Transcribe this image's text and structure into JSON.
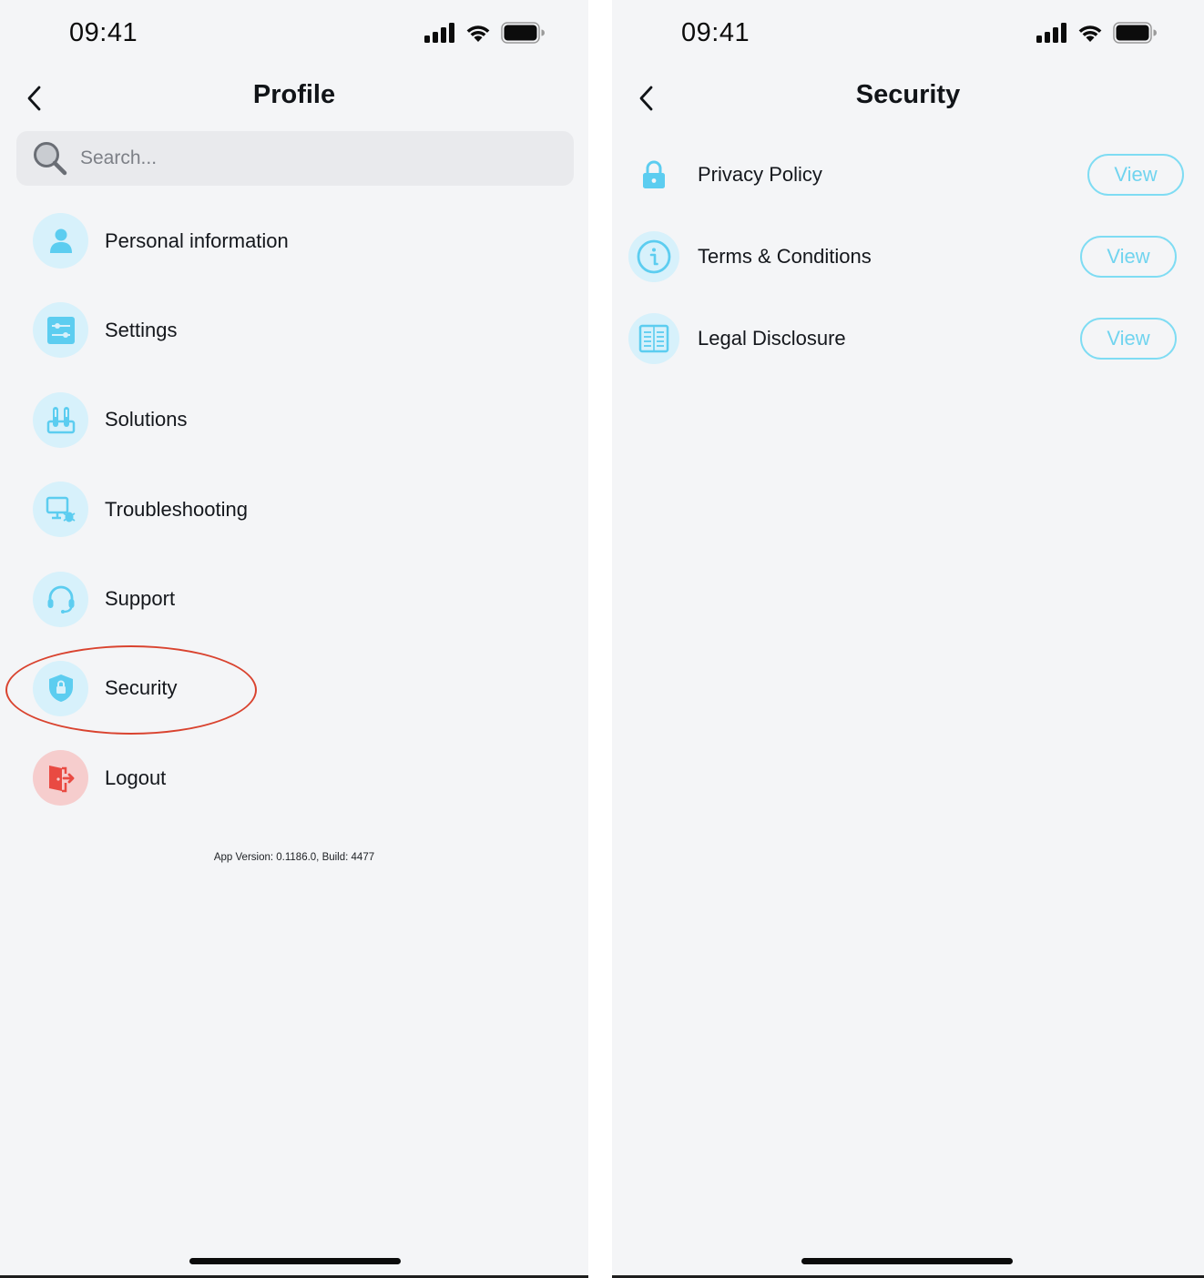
{
  "left_screen": {
    "status": {
      "time": "09:41"
    },
    "header": {
      "title": "Profile"
    },
    "search": {
      "placeholder": "Search..."
    },
    "menu": [
      {
        "label": "Personal information",
        "icon": "user-icon"
      },
      {
        "label": "Settings",
        "icon": "sliders-icon"
      },
      {
        "label": "Solutions",
        "icon": "test-tubes-icon"
      },
      {
        "label": "Troubleshooting",
        "icon": "monitor-bug-icon"
      },
      {
        "label": "Support",
        "icon": "headset-icon"
      },
      {
        "label": "Security",
        "icon": "shield-lock-icon"
      },
      {
        "label": "Logout",
        "icon": "logout-door-icon"
      }
    ],
    "app_version": "App Version: 0.1186.0, Build: 4477"
  },
  "right_screen": {
    "status": {
      "time": "09:41"
    },
    "header": {
      "title": "Security"
    },
    "items": [
      {
        "label": "Privacy Policy",
        "button": "View",
        "icon": "lock-icon"
      },
      {
        "label": "Terms & Conditions",
        "button": "View",
        "icon": "info-icon"
      },
      {
        "label": "Legal Disclosure",
        "button": "View",
        "icon": "document-icon"
      }
    ]
  },
  "colors": {
    "background": "#f4f5f7",
    "icon_circle": "#d7f1fb",
    "icon_accent": "#5ccdf0",
    "logout_circle": "#f6cdcd",
    "logout_accent": "#e94a42",
    "view_button": "#71d4ef",
    "highlight": "#d9432f"
  }
}
